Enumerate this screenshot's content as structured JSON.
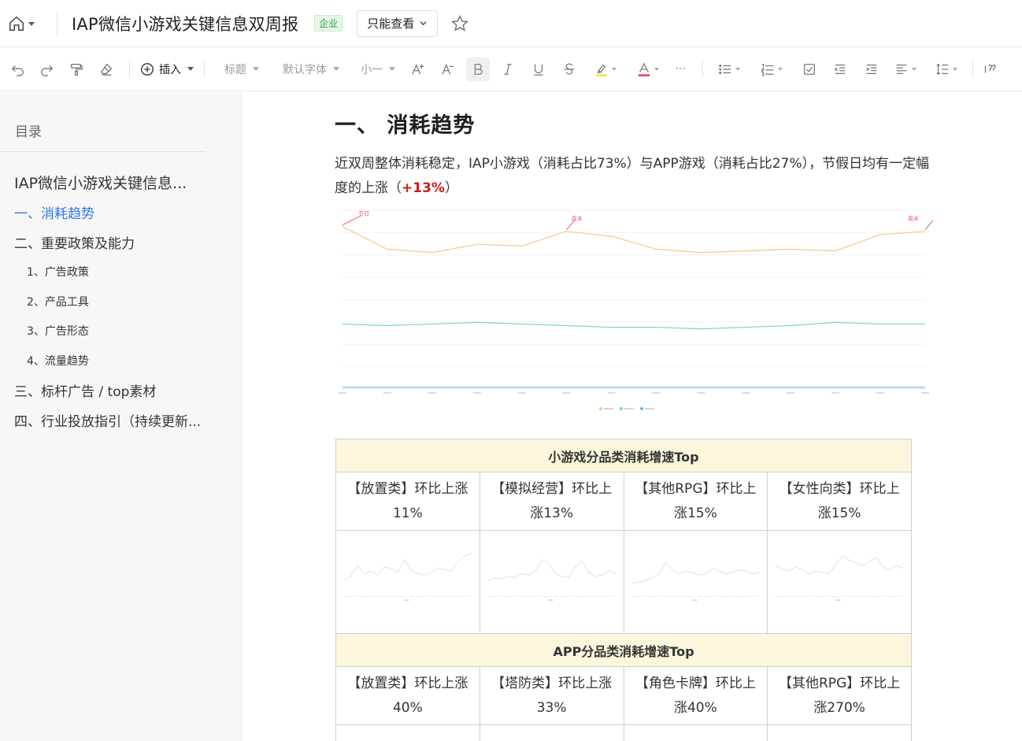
{
  "header": {
    "title": "IAP微信小游戏关键信息双周报",
    "badge": "企业",
    "mode_label": "只能查看"
  },
  "toolbar": {
    "insert_label": "插入",
    "heading_label": "标题",
    "font_label": "默认字体",
    "size_label": "小一",
    "more_label": "···"
  },
  "sidebar": {
    "title": "目录",
    "items": [
      {
        "label": "IAP微信小游戏关键信息..."
      },
      {
        "label": "一、消耗趋势"
      },
      {
        "label": "二、重要政策及能力"
      },
      {
        "label": "1、广告政策"
      },
      {
        "label": "2、产品工具"
      },
      {
        "label": "3、广告形态"
      },
      {
        "label": "4、流量趋势"
      },
      {
        "label": "三、标杆广告 / top素材"
      },
      {
        "label": "四、行业投放指引（持续更新..."
      }
    ]
  },
  "main": {
    "heading": "一、 消耗趋势",
    "para_before": "近双周整体消耗稳定，IAP小游戏（消耗占比73%）与APP游戏（消耗占比27%），节假日均有一定幅度的上涨（",
    "para_highlight": "+13%",
    "para_after": "）"
  },
  "chart_data": {
    "type": "line",
    "series": [
      {
        "color": "#f5c98a",
        "values": [
          100,
          86,
          84,
          89,
          88,
          97,
          94,
          86,
          84,
          85,
          86,
          85,
          95,
          97
        ]
      },
      {
        "color": "#7fd3c1",
        "values": [
          40,
          39,
          40,
          41,
          40,
          39,
          38,
          38,
          37,
          38,
          39,
          41,
          40,
          40
        ]
      },
      {
        "color": "#6ab0e8",
        "values": [
          1,
          1,
          1,
          1,
          1,
          1,
          1,
          1,
          1,
          1,
          1,
          1,
          1,
          1
        ]
      }
    ],
    "annotations": [
      {
        "label": "节日",
        "index": 0
      },
      {
        "label": "周末",
        "index": 5
      },
      {
        "label": "周末",
        "index": 13
      }
    ],
    "ylim": [
      0,
      110
    ]
  },
  "table": {
    "mini_header": "小游戏分品类消耗增速Top",
    "mini_cells": [
      "【放置类】环比上涨11%",
      "【模拟经营】环比上涨13%",
      "【其他RPG】环比上涨15%",
      "【女性向类】环比上涨15%"
    ],
    "app_header": "APP分品类消耗增速Top",
    "app_cells": [
      "【放置类】环比上涨40%",
      "【塔防类】环比上涨33%",
      "【角色卡牌】环比上涨40%",
      "【其他RPG】环比上涨270%"
    ],
    "sparks": [
      [
        30,
        36,
        52,
        40,
        44,
        38,
        50,
        48,
        42,
        60,
        45,
        40,
        38,
        42,
        48,
        46,
        44,
        58,
        66,
        70
      ],
      [
        30,
        34,
        32,
        36,
        34,
        40,
        38,
        44,
        60,
        56,
        40,
        36,
        34,
        50,
        58,
        42,
        36,
        38,
        44,
        40
      ],
      [
        26,
        28,
        30,
        34,
        40,
        56,
        46,
        40,
        44,
        42,
        38,
        40,
        48,
        44,
        40,
        42,
        46,
        44,
        40,
        42
      ],
      [
        52,
        48,
        44,
        50,
        46,
        40,
        44,
        42,
        40,
        54,
        66,
        60,
        56,
        52,
        58,
        64,
        50,
        46,
        52,
        48
      ]
    ]
  }
}
